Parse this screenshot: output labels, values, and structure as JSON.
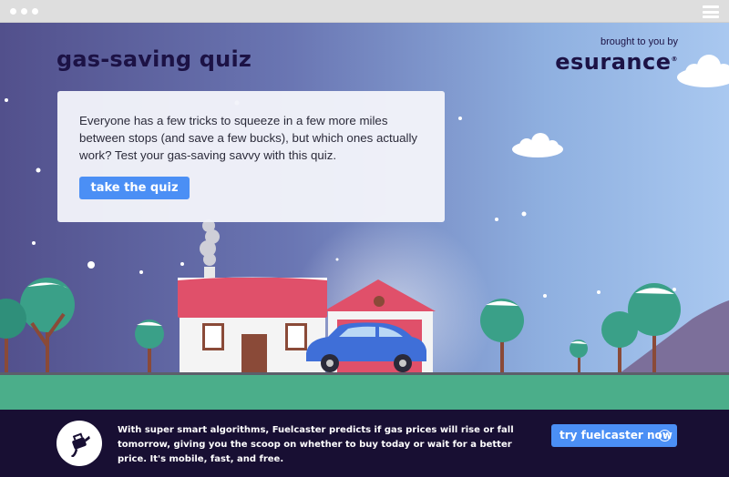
{
  "quiz": {
    "title": "gas-saving quiz",
    "intro": "Everyone has a few tricks to squeeze in a few more miles between stops (and save a few bucks), but which ones actually work? Test your gas-saving savvy with this quiz.",
    "cta_label": "take the quiz"
  },
  "sponsor": {
    "text": "brought to you by",
    "brand": "esurance"
  },
  "footer": {
    "text": "With super smart algorithms, Fuelcaster predicts if gas prices will rise or fall tomorrow, giving you the scoop on whether to buy today or wait for a better price. It's mobile, fast, and free.",
    "cta_label": "try fuelcaster now",
    "cta_icon": "arrow-right-circle-icon"
  },
  "colors": {
    "sky_left": "#52508c",
    "sky_right": "#a9c8f0",
    "ground": "#4bae8a",
    "footer_bg": "#180f33",
    "button": "#4b8ff5",
    "title": "#1c1245"
  }
}
